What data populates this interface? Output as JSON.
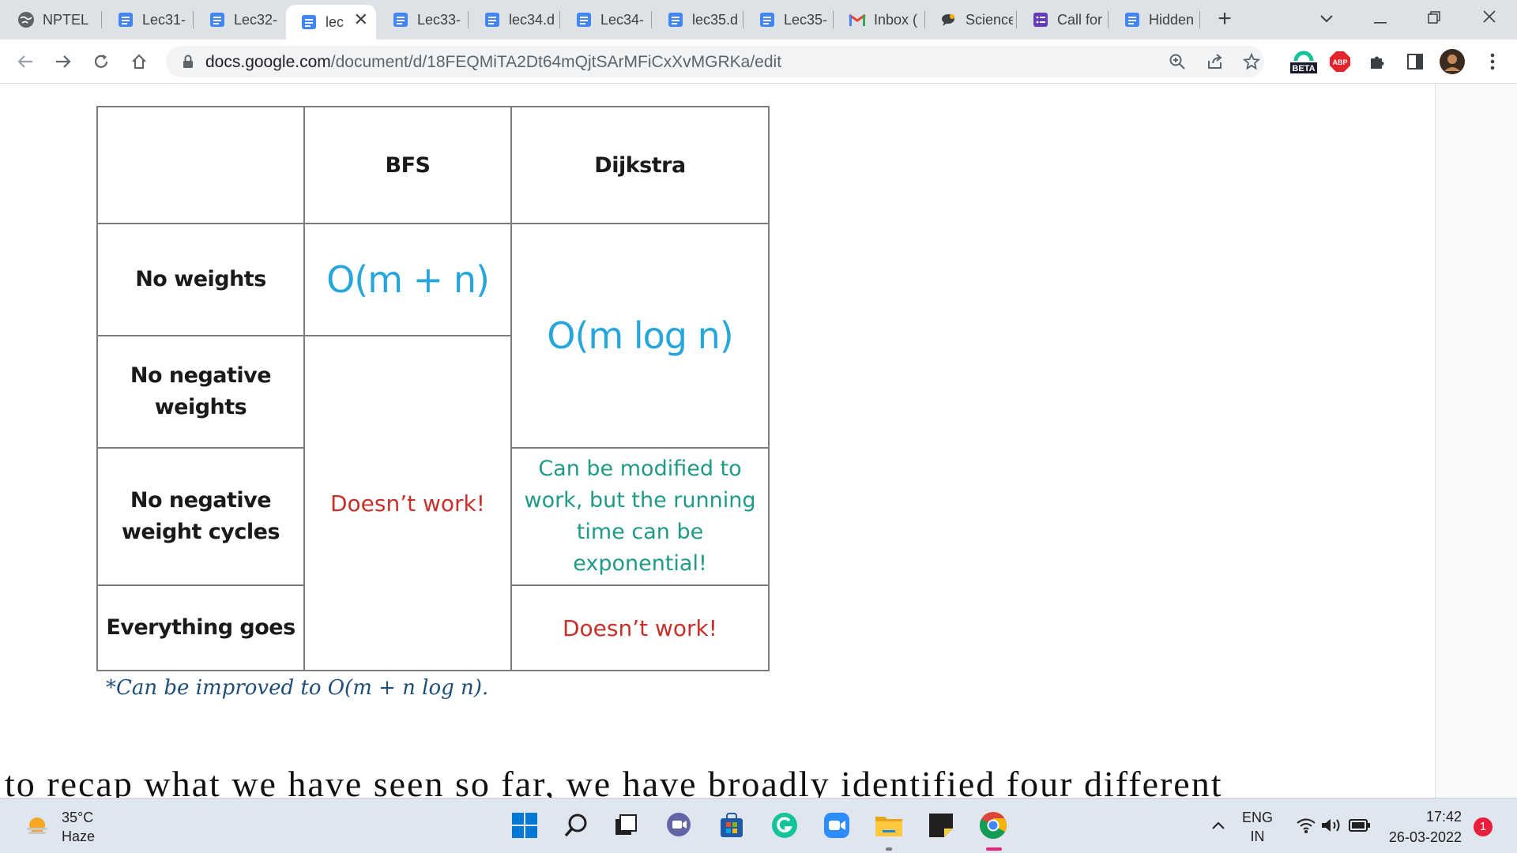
{
  "browser": {
    "tabs": [
      {
        "label": "NPTEL",
        "icon": "globe-icon"
      },
      {
        "label": "Lec31-",
        "icon": "docs-icon"
      },
      {
        "label": "Lec32-",
        "icon": "docs-icon"
      },
      {
        "label": "lec",
        "icon": "docs-icon",
        "active": true
      },
      {
        "label": "Lec33-",
        "icon": "docs-icon"
      },
      {
        "label": "lec34.d",
        "icon": "docs-icon"
      },
      {
        "label": "Lec34-",
        "icon": "docs-icon"
      },
      {
        "label": "lec35.d",
        "icon": "docs-icon"
      },
      {
        "label": "Lec35-",
        "icon": "docs-icon"
      },
      {
        "label": "Inbox (",
        "icon": "gmail-icon"
      },
      {
        "label": "Science",
        "icon": "chat-bubble-icon"
      },
      {
        "label": "Call for",
        "icon": "forms-icon"
      },
      {
        "label": "Hidden",
        "icon": "docs-icon"
      }
    ],
    "url_host": "docs.google.com",
    "url_path": "/document/d/18FEQMiTA2Dt64mQjtSArMFiCxXvMGRKa/edit",
    "beta_label": "BETA",
    "abp_label": "ABP"
  },
  "table": {
    "headers": [
      "",
      "BFS",
      "Dijkstra"
    ],
    "row_labels": [
      "No weights",
      "No negative weights",
      "No negative weight cycles",
      "Everything goes"
    ],
    "bfs_no_weights": "O(m + n)",
    "bfs_other": "Doesn’t work!",
    "dijkstra_nonneg": "O(m log n)",
    "dijkstra_neg_cycles": "Can be modified to work, but the running time can be exponential!",
    "dijkstra_everything": "Doesn’t work!"
  },
  "footnote": "*Can be improved to O(m + n log n).",
  "body_text": "to recap what we have seen so far, we have broadly identified four different",
  "taskbar": {
    "temperature": "35°C",
    "condition": "Haze",
    "lang_primary": "ENG",
    "lang_region": "IN",
    "time": "17:42",
    "date": "26-03-2022",
    "notifications": "1"
  },
  "colors": {
    "complexity_blue": "#27a6dc",
    "fail_red": "#c8312b",
    "note_green": "#1f9a86"
  }
}
